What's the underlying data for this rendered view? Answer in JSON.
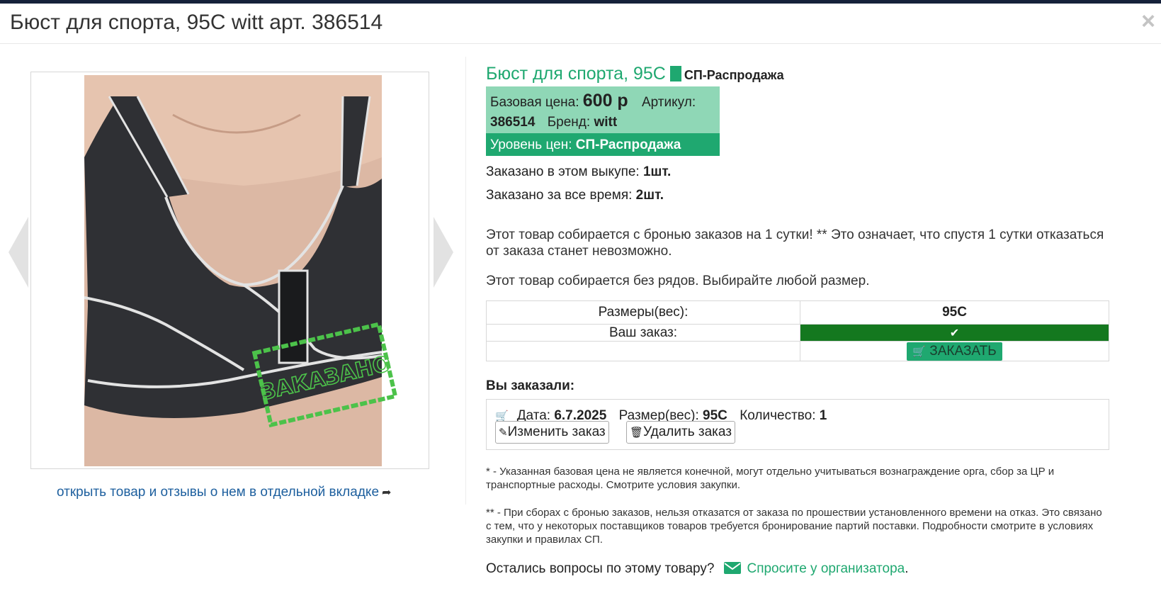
{
  "modal": {
    "title": "Бюст для спорта, 95C witt арт. 386514",
    "close_label": "×"
  },
  "gallery": {
    "stamp_text": "ЗАКАЗАНО",
    "open_link": "открыть товар и отзывы о нем в отдельной вкладке",
    "open_link_icon": "share-arrow-icon"
  },
  "product": {
    "name": "Бюст для спорта, 95C",
    "price_level_badge": "СП-Распродажа",
    "base_price_label": "Базовая цена:",
    "base_price": "600 р",
    "article_label": "Артикул:",
    "article": "386514",
    "brand_label": "Бренд:",
    "brand": "witt",
    "level_label": "Уровень цен:",
    "level": "СП-Распродажа"
  },
  "stats": {
    "ordered_in_purchase_label": "Заказано в этом выкупе:",
    "ordered_in_purchase": "1шт.",
    "ordered_total_label": "Заказано за все время:",
    "ordered_total": "2шт."
  },
  "notices": {
    "reservation": "Этот товар собирается с бронью заказов на 1 сутки! ** Это означает, что спустя 1 сутки отказаться от заказа станет невозможно.",
    "no_rows": "Этот товар собирается без рядов. Выбирайте любой размер."
  },
  "size_table": {
    "sizes_label": "Размеры(вес):",
    "size_value": "95C",
    "your_order_label": "Ваш заказ:",
    "check_mark": "✔",
    "order_button": "ЗАКАЗАТЬ"
  },
  "your_orders": {
    "heading": "Вы заказали:",
    "date_label": "Дата:",
    "date": "6.7.2025",
    "size_label": "Размер(вес):",
    "size": "95C",
    "qty_label": "Количество:",
    "qty": "1",
    "edit_button": "Изменить заказ",
    "delete_button": "Удалить заказ"
  },
  "footnotes": {
    "price_note": "* - Указанная базовая цена не является конечной, могут отдельно учитываться вознаграждение орга, сбор за ЦР и транспортные расходы. Смотрите условия закупки.",
    "reservation_note": "** - При сборах с бронью заказов, нельзя отказатся от заказа по прошествии установленного времени на отказ. Это связано с тем, что у некоторых поставщиков товаров требуется бронирование партий поставки. Подробности смотрите в условиях закупки и правилах СП."
  },
  "question": {
    "text": "Остались вопросы по этому товару?",
    "link": "Спросите у организатора",
    "period": "."
  },
  "colors": {
    "accent": "#1fa870",
    "price_box": "#8fd7b6",
    "ordered_cell": "#14781f",
    "link": "#1d5f9e",
    "topbar": "#16213a"
  }
}
